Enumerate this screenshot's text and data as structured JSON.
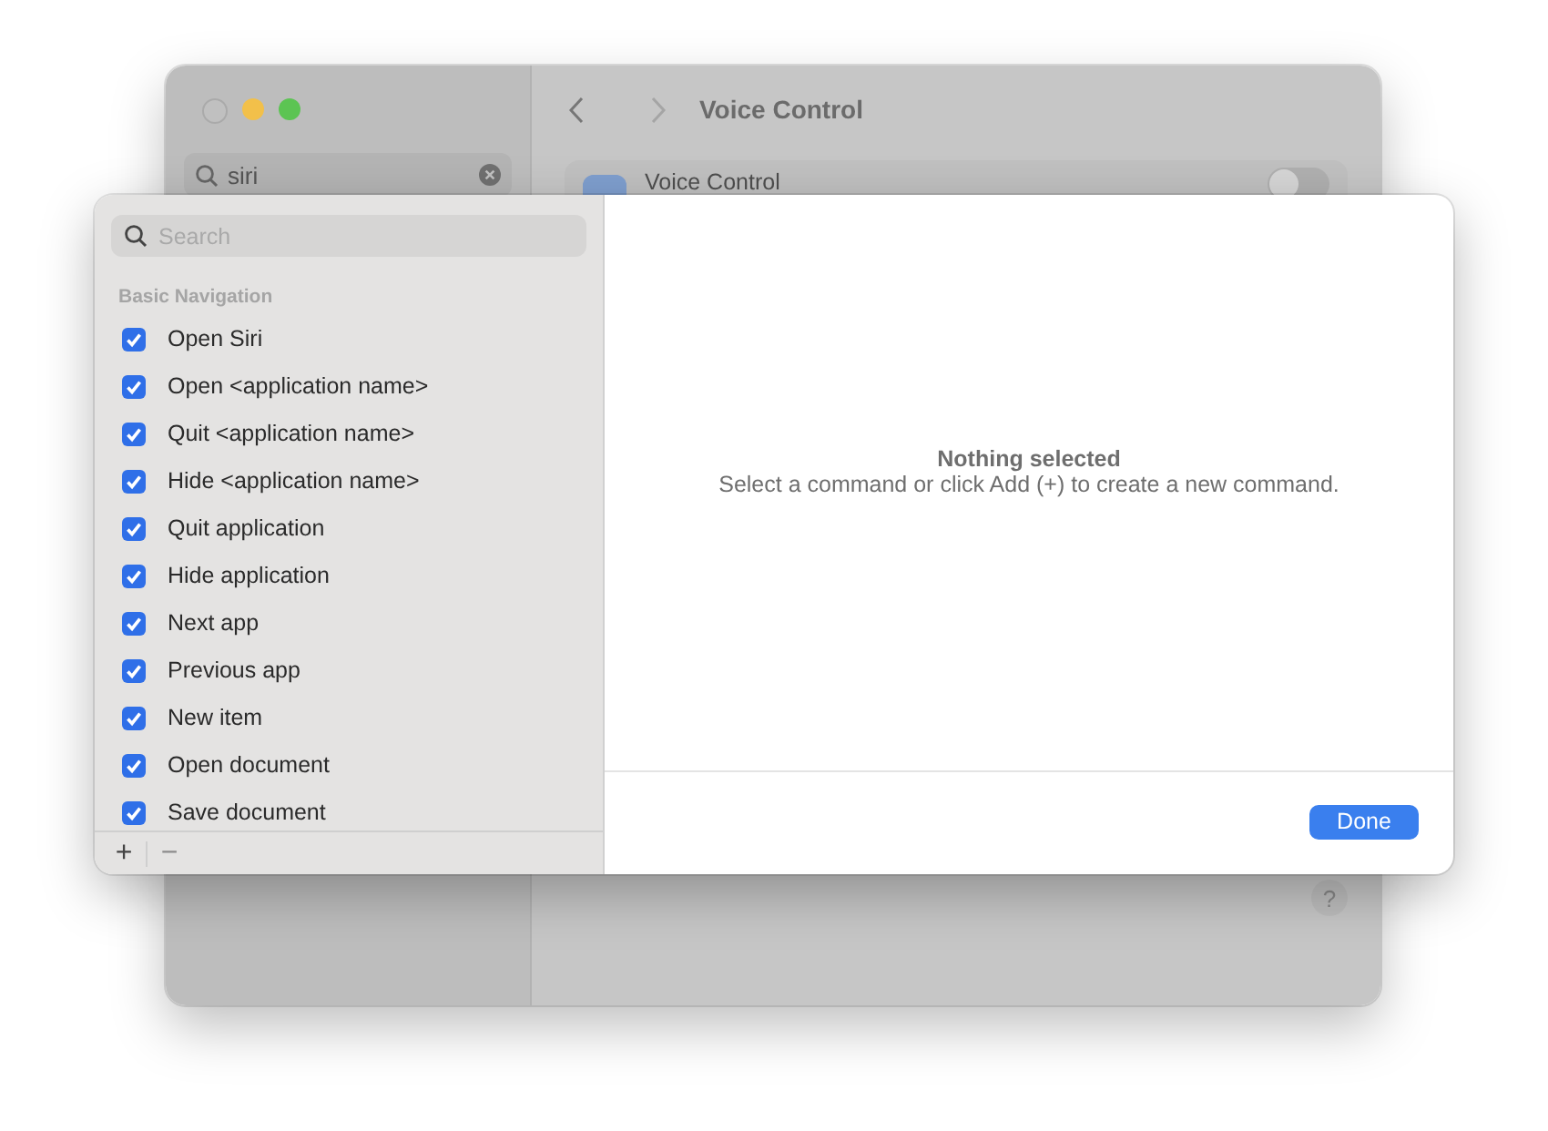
{
  "background_window": {
    "search": {
      "value": "siri"
    },
    "title": "Voice Control",
    "settings_row": {
      "label": "Voice Control",
      "on": false
    },
    "help_button": "?"
  },
  "sheet": {
    "search": {
      "placeholder": "Search"
    },
    "section_title": "Basic Navigation",
    "commands": [
      {
        "label": "Open Siri",
        "checked": true
      },
      {
        "label": "Open <application name>",
        "checked": true
      },
      {
        "label": "Quit <application name>",
        "checked": true
      },
      {
        "label": "Hide <application name>",
        "checked": true
      },
      {
        "label": "Quit application",
        "checked": true
      },
      {
        "label": "Hide application",
        "checked": true
      },
      {
        "label": "Next app",
        "checked": true
      },
      {
        "label": "Previous app",
        "checked": true
      },
      {
        "label": "New item",
        "checked": true
      },
      {
        "label": "Open document",
        "checked": true
      },
      {
        "label": "Save document",
        "checked": true
      }
    ],
    "add_button": "+",
    "remove_button": {
      "label": "−",
      "disabled": true
    },
    "empty_state": {
      "title": "Nothing selected",
      "message": "Select a command or click Add (+) to create a new command."
    },
    "done_button": "Done"
  }
}
